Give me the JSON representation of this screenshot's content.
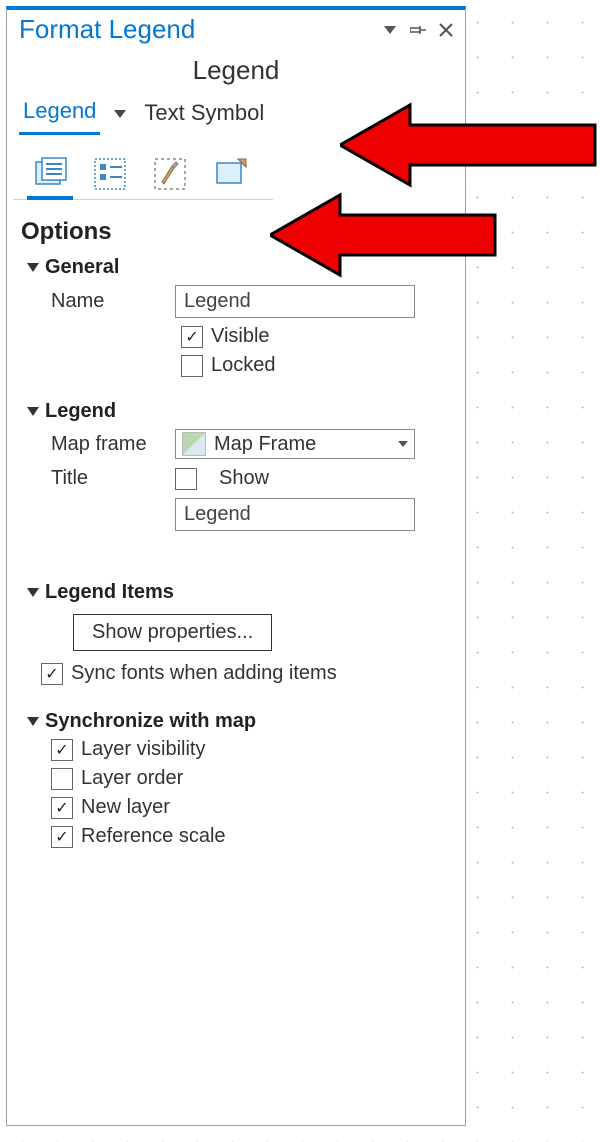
{
  "panel": {
    "title": "Format Legend",
    "subtitle": "Legend"
  },
  "tabs": {
    "legend": "Legend",
    "text_symbol": "Text Symbol"
  },
  "sections": {
    "options": "Options",
    "general": "General",
    "legend": "Legend",
    "legend_items": "Legend Items",
    "sync_map": "Synchronize with map"
  },
  "general": {
    "name_label": "Name",
    "name_value": "Legend",
    "visible_label": "Visible",
    "visible_checked": true,
    "locked_label": "Locked",
    "locked_checked": false
  },
  "legend": {
    "map_frame_label": "Map frame",
    "map_frame_value": "Map Frame",
    "title_label": "Title",
    "show_label": "Show",
    "show_checked": false,
    "title_value": "Legend"
  },
  "legend_items": {
    "show_props": "Show properties...",
    "sync_fonts_label": "Sync fonts when adding items",
    "sync_fonts_checked": true
  },
  "sync_map": {
    "layer_visibility_label": "Layer visibility",
    "layer_visibility_checked": true,
    "layer_order_label": "Layer order",
    "layer_order_checked": false,
    "new_layer_label": "New layer",
    "new_layer_checked": true,
    "reference_scale_label": "Reference scale",
    "reference_scale_checked": true
  }
}
